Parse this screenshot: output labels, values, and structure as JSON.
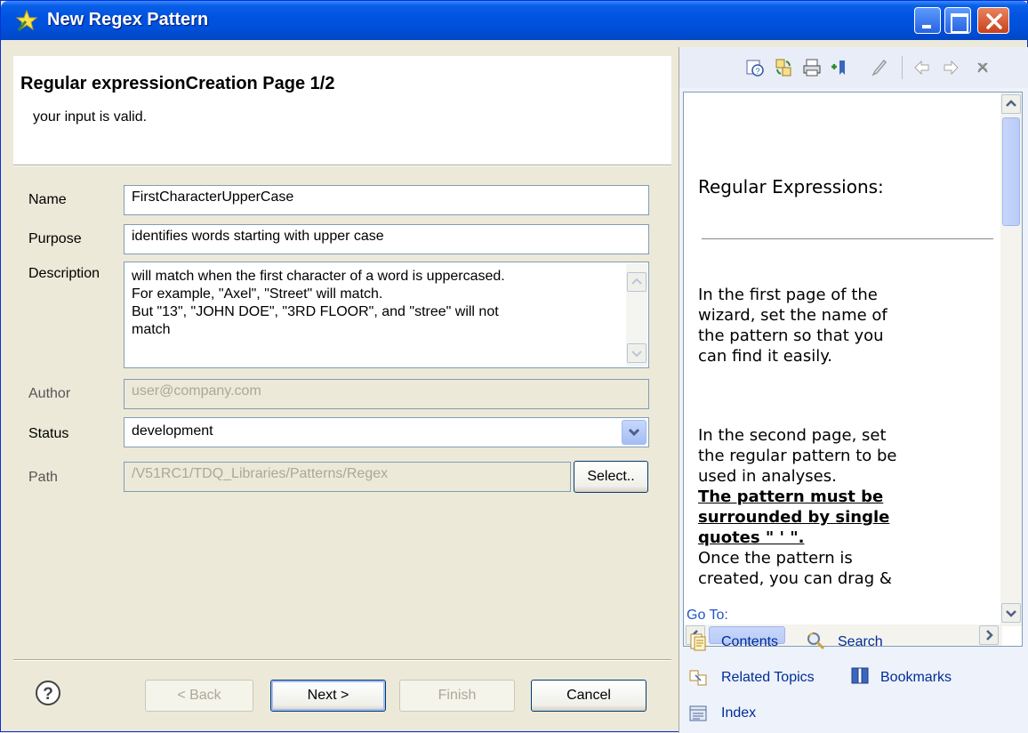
{
  "window": {
    "title": "New Regex Pattern",
    "title_icon": "star-wand-icon",
    "controls": [
      "minimize-icon",
      "maximize-icon",
      "close-icon"
    ]
  },
  "header": {
    "title": "Regular expressionCreation Page 1/2",
    "message": "your input is valid."
  },
  "form": {
    "name_label": "Name",
    "name_value": "FirstCharacterUpperCase",
    "purpose_label": "Purpose",
    "purpose_value": "identifies words starting with upper case",
    "description_label": "Description",
    "description_lines": [
      "will match when the first character of a word is uppercased.",
      "For example, \"Axel\", \"Street\" will match.",
      "But \"13\", \"JOHN DOE\", \"3RD FLOOR\", and \"stree\" will not",
      "match"
    ],
    "author_label": "Author",
    "author_value": "user@company.com",
    "status_label": "Status",
    "status_value": "development",
    "path_label": "Path",
    "path_value": "/V51RC1/TDQ_Libraries/Patterns/Regex",
    "select_label": "Select.."
  },
  "footer": {
    "back_label": "< Back",
    "next_label": "Next >",
    "finish_label": "Finish",
    "cancel_label": "Cancel",
    "help_icon": "help-circle-icon"
  },
  "help": {
    "toolbar_icons": [
      "show-in-contents-icon",
      "sync-toc-icon",
      "print-icon",
      "bookmark-add-icon",
      "highlight-icon",
      "back-icon",
      "forward-icon",
      "close-icon"
    ],
    "title": "Regular Expressions:",
    "p1": [
      "In the first page of the",
      "wizard, set the name of",
      "the pattern so that you",
      "can find it easily."
    ],
    "p2": [
      "In the second page, set",
      "the regular pattern to be",
      "used in analyses."
    ],
    "bold": [
      "The pattern must be",
      "surrounded by single",
      "quotes \" ' \"."
    ],
    "p3": [
      "Once the pattern is",
      "created, you can drag &"
    ],
    "goto_label": "Go To:",
    "links": {
      "contents": "Contents",
      "search": "Search",
      "related": "Related Topics",
      "bookmarks": "Bookmarks",
      "index": "Index"
    }
  }
}
